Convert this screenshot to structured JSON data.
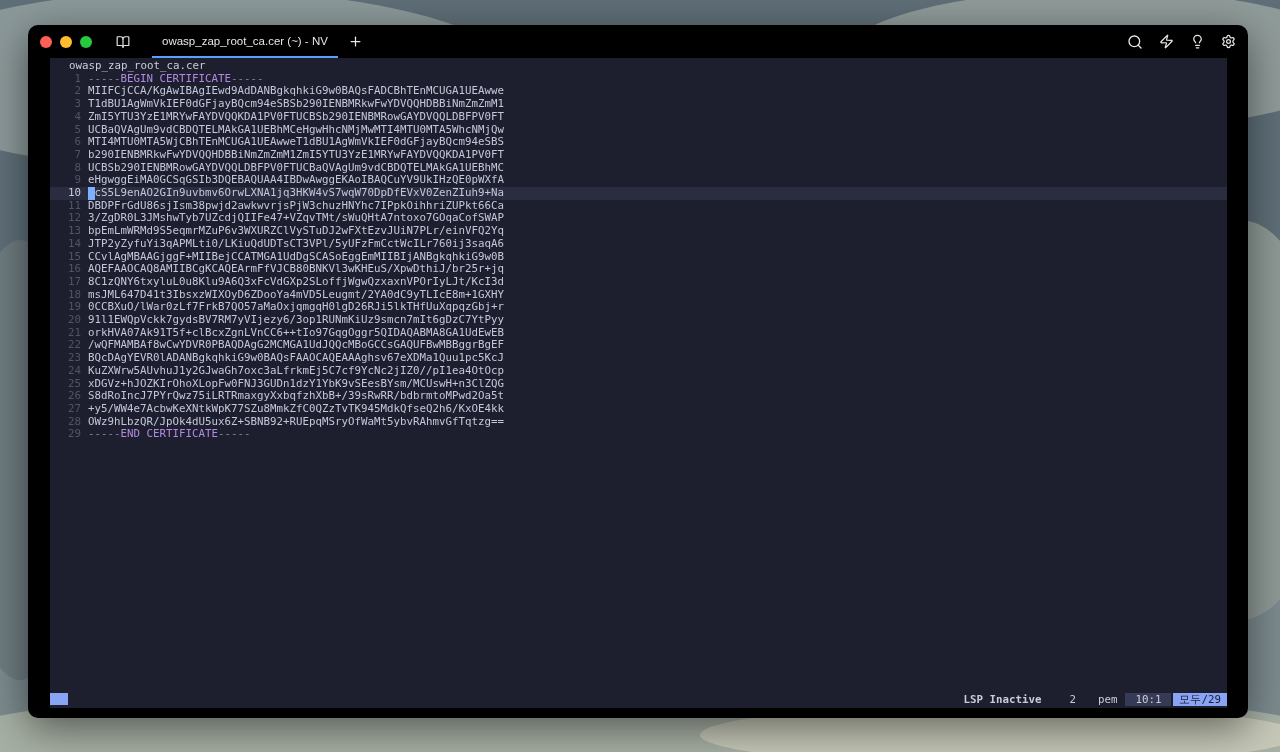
{
  "window": {
    "tab": {
      "title": "owasp_zap_root_ca.cer (~) - NV",
      "selected": true
    }
  },
  "editor": {
    "file_name": "owasp_zap_root_ca.cer",
    "lines": [
      {
        "number": "1",
        "kind": "marker",
        "parts": [
          {
            "kind": "punct",
            "text": "-----"
          },
          {
            "kind": "keyword",
            "text": "BEGIN CERTIFICATE"
          },
          {
            "kind": "punct",
            "text": "-----"
          }
        ],
        "selected": false
      },
      {
        "number": "2",
        "kind": "data",
        "text": "MIIFCjCCA/KgAwIBAgIEwd9AdDANBgkqhkiG9w0BAQsFADCBhTEnMCUGA1UEAwwe",
        "selected": false
      },
      {
        "number": "3",
        "kind": "data",
        "text": "T1dBU1AgWmVkIEF0dGFjayBQcm94eSBSb290IENBMRkwFwYDVQQHDBBiNmZmZmM1",
        "selected": false
      },
      {
        "number": "4",
        "kind": "data",
        "text": "ZmI5YTU3YzE1MRYwFAYDVQQKDA1PV0FTUCBSb290IENBMRowGAYDVQQLDBFPV0FT",
        "selected": false
      },
      {
        "number": "5",
        "kind": "data",
        "text": "UCBaQVAgUm9vdCBDQTELMAkGA1UEBhMCeHgwHhcNMjMwMTI4MTU0MTA5WhcNMjQw",
        "selected": false
      },
      {
        "number": "6",
        "kind": "data",
        "text": "MTI4MTU0MTA5WjCBhTEnMCUGA1UEAwweT1dBU1AgWmVkIEF0dGFjayBQcm94eSBS",
        "selected": false
      },
      {
        "number": "7",
        "kind": "data",
        "text": "b290IENBMRkwFwYDVQQHDBBiNmZmZmM1ZmI5YTU3YzE1MRYwFAYDVQQKDA1PV0FT",
        "selected": false
      },
      {
        "number": "8",
        "kind": "data",
        "text": "UCBSb290IENBMRowGAYDVQQLDBFPV0FTUCBaQVAgUm9vdCBDQTELMAkGA1UEBhMC",
        "selected": false
      },
      {
        "number": "9",
        "kind": "data",
        "text": "eHgwggEiMA0GCSqGSIb3DQEBAQUAA4IBDwAwggEKAoIBAQCuYV9UkIHzQE0pWXfA",
        "selected": false
      },
      {
        "number": "10",
        "kind": "data",
        "text": "cS5L9enAO2GIn9uvbmv6OrwLXNA1jq3HKW4vS7wqW70DpDfEVxV0ZenZIuh9+Na",
        "selected": true
      },
      {
        "number": "11",
        "kind": "data",
        "text": "DBDPFrGdU86sjIsm38pwjd2awkwvrjsPjW3chuzHNYhc7IPpkOihhriZUPkt66Ca",
        "selected": false
      },
      {
        "number": "12",
        "kind": "data",
        "text": "3/ZgDR0L3JMshwTyb7UZcdjQIIFe47+VZqvTMt/sWuQHtA7ntoxo7GOqaCofSWAP",
        "selected": false
      },
      {
        "number": "13",
        "kind": "data",
        "text": "bpEmLmWRMd9S5eqmrMZuP6v3WXURZClVySTuDJ2wFXtEzvJUiN7PLr/einVFQ2Yq",
        "selected": false
      },
      {
        "number": "14",
        "kind": "data",
        "text": "JTP2yZyfuYi3qAPMLti0/LKiuQdUDTsCT3VPl/5yUFzFmCctWcILr760ij3saqA6",
        "selected": false
      },
      {
        "number": "15",
        "kind": "data",
        "text": "CCvlAgMBAAGjggF+MIIBejCCATMGA1UdDgSCASoEggEmMIIBIjANBgkqhkiG9w0B",
        "selected": false
      },
      {
        "number": "16",
        "kind": "data",
        "text": "AQEFAAOCAQ8AMIIBCgKCAQEArmFfVJCB80BNKVl3wKHEuS/XpwDthiJ/br25r+jq",
        "selected": false
      },
      {
        "number": "17",
        "kind": "data",
        "text": "8C1zQNY6txyluL0u8Klu9A6Q3xFcVdGXp2SLoffjWgwQzxaxnVPOrIyLJt/KcI3d",
        "selected": false
      },
      {
        "number": "18",
        "kind": "data",
        "text": "msJML647D41t3IbsxzWIXOyD6ZDooYa4mVD5Leugmt/2YA0dC9yTLIcE8m+1GXHY",
        "selected": false
      },
      {
        "number": "19",
        "kind": "data",
        "text": "0CCBXuO/lWar0zLf7FrkB7QO57aMaOxjqmgqH0lgD26RJi5lkTHfUuXqpqzGbj+r",
        "selected": false
      },
      {
        "number": "20",
        "kind": "data",
        "text": "91l1EWQpVckk7gydsBV7RM7yVIjezy6/3op1RUNmKiUz9smcn7mIt6gDzC7YtPyy",
        "selected": false
      },
      {
        "number": "21",
        "kind": "data",
        "text": "orkHVA07Ak91T5f+clBcxZgnLVnCC6++tIo97GqgOggr5QIDAQABMA8GA1UdEwEB",
        "selected": false
      },
      {
        "number": "22",
        "kind": "data",
        "text": "/wQFMAMBAf8wCwYDVR0PBAQDAgG2MCMGA1UdJQQcMBoGCCsGAQUFBwMBBggrBgEF",
        "selected": false
      },
      {
        "number": "23",
        "kind": "data",
        "text": "BQcDAgYEVR0lADANBgkqhkiG9w0BAQsFAAOCAQEAAAghsv67eXDMa1Quu1pc5KcJ",
        "selected": false
      },
      {
        "number": "24",
        "kind": "data",
        "text": "KuZXWrw5AUvhuJ1y2GJwaGh7oxc3aLfrkmEj5C7cf9YcNc2jIZ0//pI1ea4OtOcp",
        "selected": false
      },
      {
        "number": "25",
        "kind": "data",
        "text": "xDGVz+hJOZKIrOhoXLopFw0FNJ3GUDn1dzY1YbK9vSEesBYsm/MCUswH+n3ClZQG",
        "selected": false
      },
      {
        "number": "26",
        "kind": "data",
        "text": "S8dRoIncJ7PYrQwz75iLRTRmaxgyXxbqfzhXbB+/39sRwRR/bdbrmtoMPwd2Oa5t",
        "selected": false
      },
      {
        "number": "27",
        "kind": "data",
        "text": "+y5/WW4e7AcbwKeXNtkWpK77SZu8MmkZfC0QZzTvTK945MdkQfseQ2h6/KxOE4kk",
        "selected": false
      },
      {
        "number": "28",
        "kind": "data",
        "text": "OWz9hLbzQR/JpOk4dU5ux6Z+SBNB92+RUEpqMSryOfWaMt5ybvRAhmvGfTqtzg==",
        "selected": false
      },
      {
        "number": "29",
        "kind": "marker",
        "parts": [
          {
            "kind": "punct",
            "text": "-----"
          },
          {
            "kind": "keyword",
            "text": "END CERTIFICATE"
          },
          {
            "kind": "punct",
            "text": "-----"
          }
        ],
        "selected": false
      }
    ]
  },
  "status_bar": {
    "lsp": "LSP Inactive",
    "count": "2",
    "filetype": "pem",
    "position": "10:1",
    "progress": "모두/29"
  }
}
